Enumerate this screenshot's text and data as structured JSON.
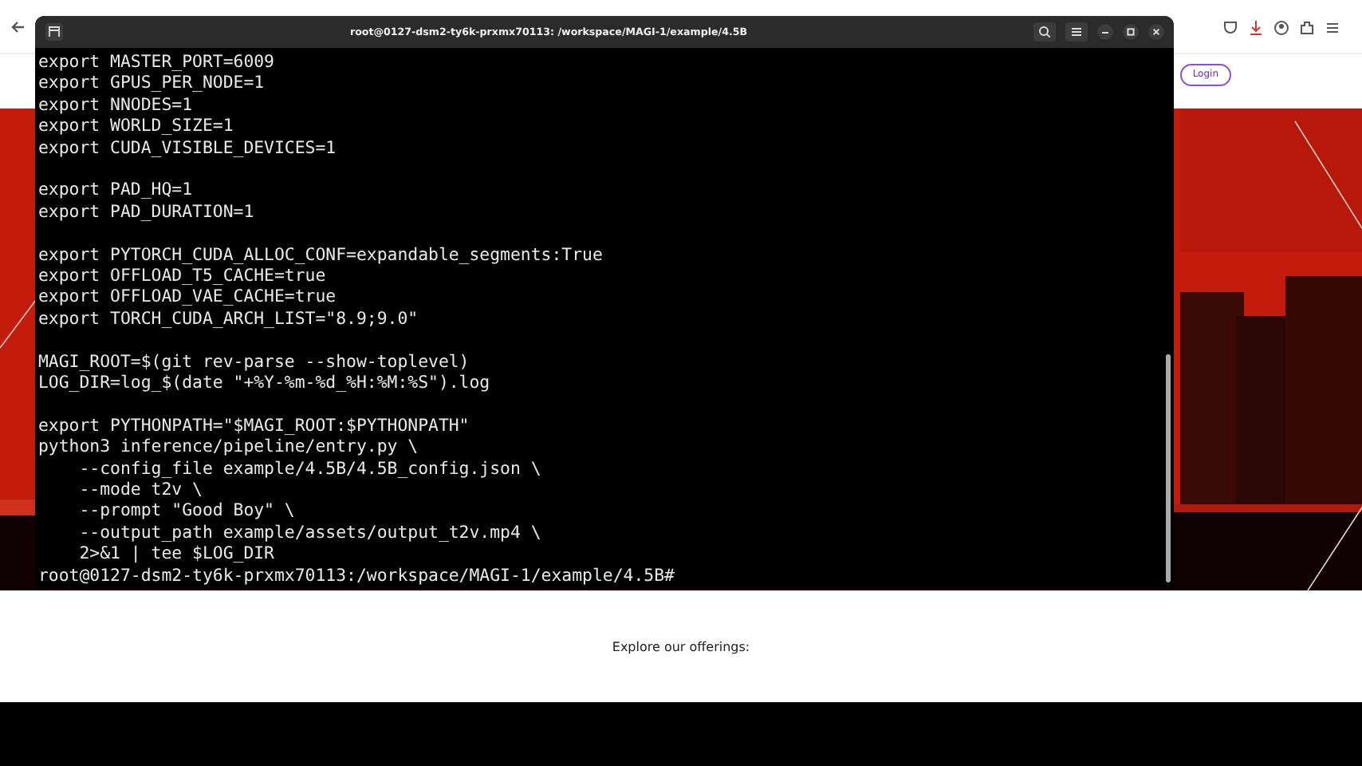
{
  "site": {
    "login_button": "Login",
    "offerings_heading": "Explore our offerings:"
  },
  "terminal": {
    "title": "root@0127-dsm2-ty6k-prxmx70113: /workspace/MAGI-1/example/4.5B",
    "blocks": [
      [
        "export MASTER_PORT=6009",
        "export GPUS_PER_NODE=1",
        "export NNODES=1",
        "export WORLD_SIZE=1",
        "export CUDA_VISIBLE_DEVICES=1"
      ],
      [
        "export PAD_HQ=1",
        "export PAD_DURATION=1"
      ],
      [
        "export PYTORCH_CUDA_ALLOC_CONF=expandable_segments:True",
        "export OFFLOAD_T5_CACHE=true",
        "export OFFLOAD_VAE_CACHE=true",
        "export TORCH_CUDA_ARCH_LIST=\"8.9;9.0\""
      ],
      [
        "MAGI_ROOT=$(git rev-parse --show-toplevel)",
        "LOG_DIR=log_$(date \"+%Y-%m-%d_%H:%M:%S\").log"
      ],
      [
        "export PYTHONPATH=\"$MAGI_ROOT:$PYTHONPATH\"",
        "python3 inference/pipeline/entry.py \\",
        "    --config_file example/4.5B/4.5B_config.json \\",
        "    --mode t2v \\",
        "    --prompt \"Good Boy\" \\",
        "    --output_path example/assets/output_t2v.mp4 \\",
        "    2>&1 | tee $LOG_DIR"
      ]
    ],
    "prompt": "root@0127-dsm2-ty6k-prxmx70113:/workspace/MAGI-1/example/4.5B#"
  }
}
